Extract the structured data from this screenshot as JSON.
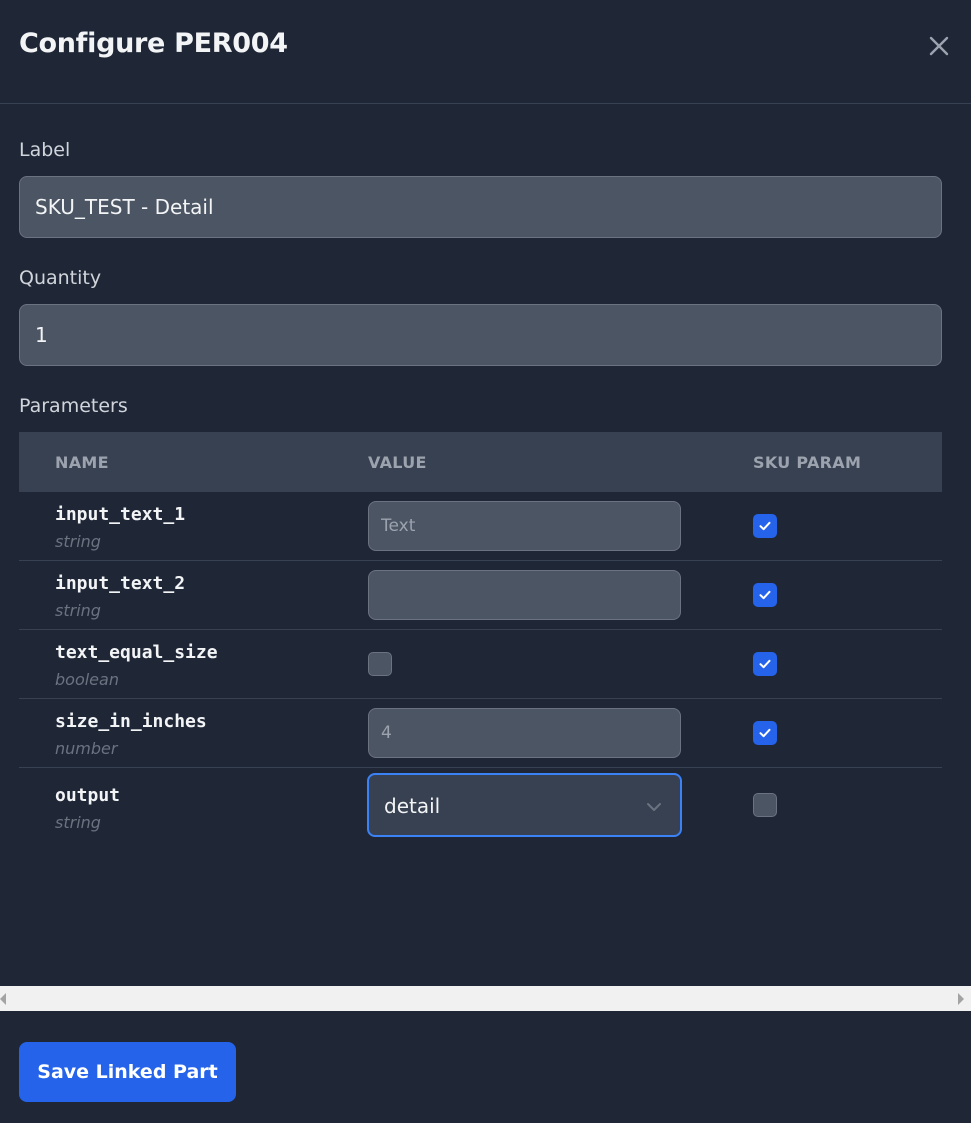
{
  "dialog": {
    "title": "Configure PER004",
    "close_icon": "close-icon"
  },
  "form": {
    "label": {
      "label": "Label",
      "value": "SKU_TEST - Detail"
    },
    "quantity": {
      "label": "Quantity",
      "value": "1"
    },
    "parameters_label": "Parameters"
  },
  "table": {
    "headers": {
      "name": "NAME",
      "value": "VALUE",
      "sku_param": "SKU PARAM"
    },
    "rows": [
      {
        "name": "input_text_1",
        "type": "string",
        "value": "",
        "placeholder": "Text",
        "sku_param": true
      },
      {
        "name": "input_text_2",
        "type": "string",
        "value": "",
        "placeholder": "",
        "sku_param": true
      },
      {
        "name": "text_equal_size",
        "type": "boolean",
        "value_checked": false,
        "sku_param": true
      },
      {
        "name": "size_in_inches",
        "type": "number",
        "value": "4",
        "placeholder": "",
        "sku_param": true
      },
      {
        "name": "output",
        "type": "string",
        "selected": "detail",
        "sku_param": false
      }
    ]
  },
  "footer": {
    "save_label": "Save Linked Part"
  },
  "colors": {
    "background": "#1f2737",
    "accent": "#2563eb",
    "input_bg": "#4b5563",
    "header_row_bg": "#374151"
  }
}
